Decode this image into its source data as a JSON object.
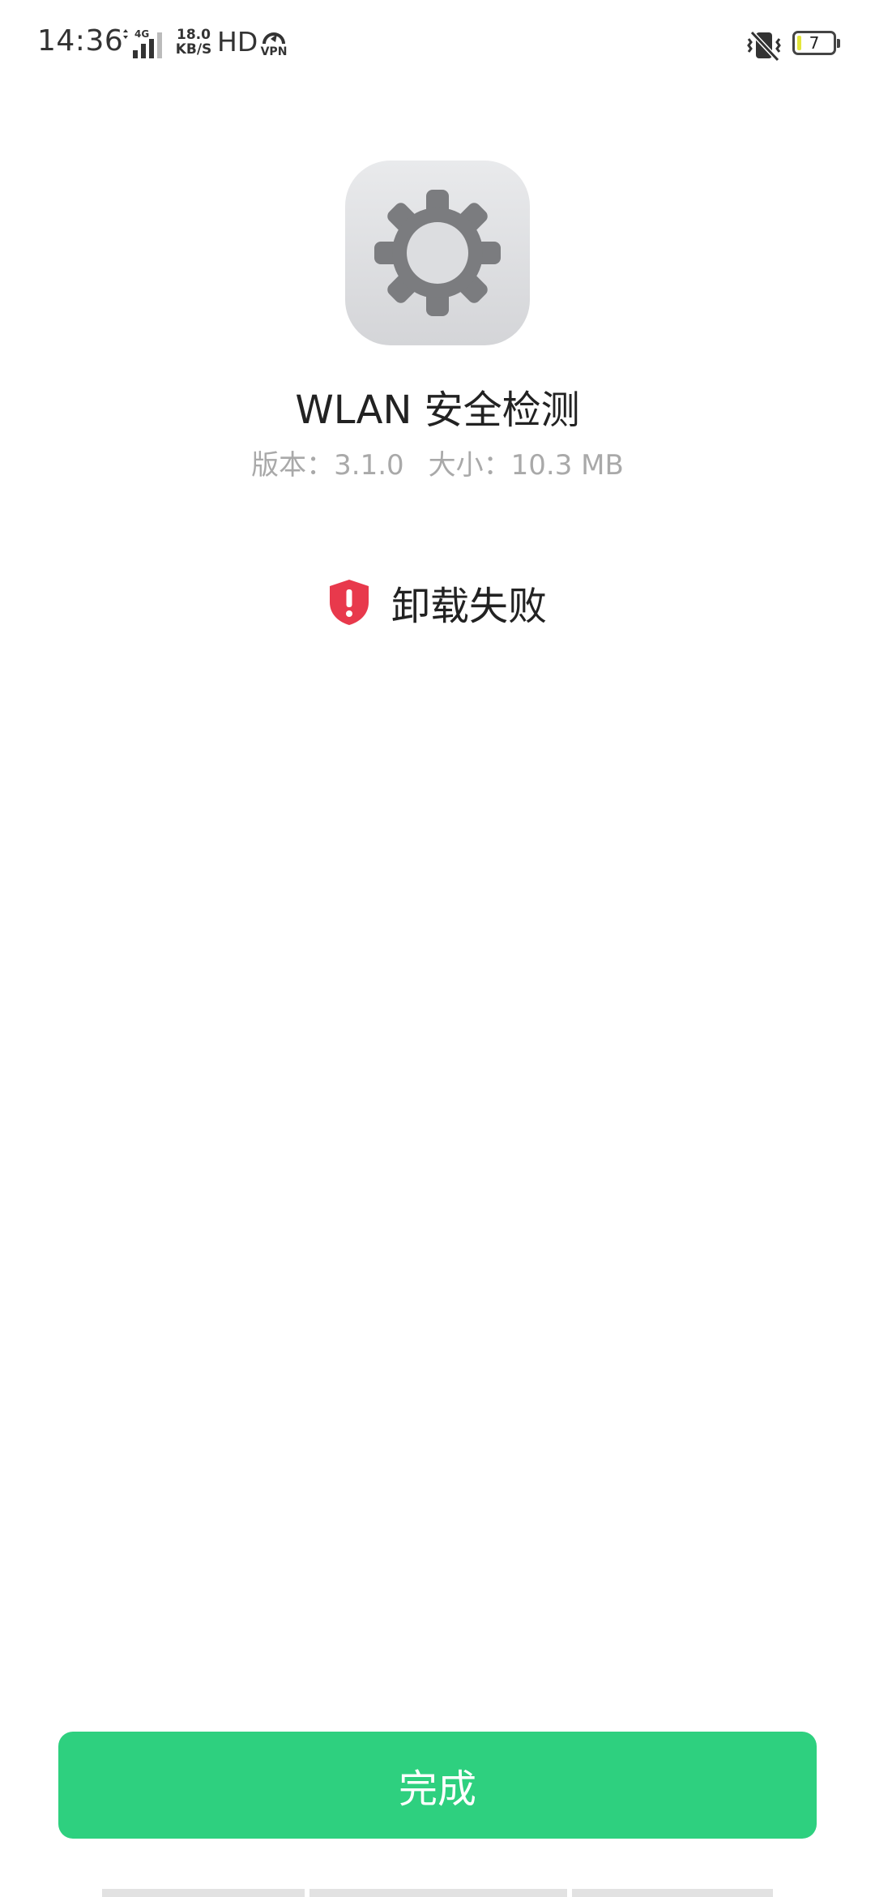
{
  "status_bar": {
    "time": "14:36",
    "network": "4G",
    "speed_value": "18.0",
    "speed_unit": "KB/S",
    "hd": "HD",
    "vpn": "VPN",
    "battery_level": "7"
  },
  "app": {
    "name": "WLAN 安全检测",
    "version": "版本：3.1.0",
    "size": "大小：10.3 MB",
    "icon": "gear-icon"
  },
  "result": {
    "icon": "shield-alert-icon",
    "text": "卸载失败",
    "color": "#e8394c"
  },
  "done_button": {
    "label": "完成",
    "color": "#2ed07f"
  }
}
